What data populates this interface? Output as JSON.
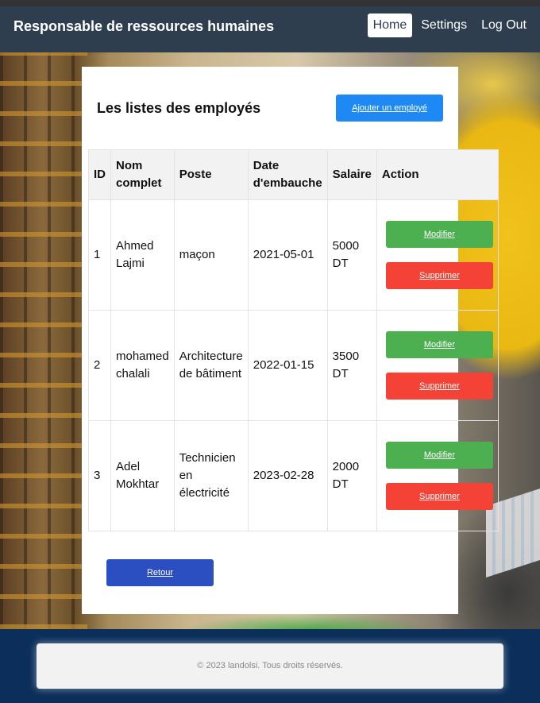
{
  "header": {
    "brand": "Responsable de ressources humaines",
    "nav": [
      {
        "label": "Home",
        "active": true
      },
      {
        "label": "Settings",
        "active": false
      },
      {
        "label": "Log Out",
        "active": false
      }
    ]
  },
  "main": {
    "title": "Les listes des employés",
    "add_button": "Ajouter un employé",
    "table": {
      "headers": [
        "ID",
        "Nom complet",
        "Poste",
        "Date d'embauche",
        "Salaire",
        "Action"
      ],
      "rows": [
        {
          "id": "1",
          "name": "Ahmed Lajmi",
          "poste": "maçon",
          "date": "2021-05-01",
          "salaire": "5000 DT"
        },
        {
          "id": "2",
          "name": "mohamed chalali",
          "poste": "Architecture de bâtiment",
          "date": "2022-01-15",
          "salaire": "3500 DT"
        },
        {
          "id": "3",
          "name": "Adel Mokhtar",
          "poste": "Technicien en électricité",
          "date": "2023-02-28",
          "salaire": "2000 DT"
        }
      ],
      "edit_label": "Modifier",
      "delete_label": "Supprimer"
    },
    "back_button": "Retour"
  },
  "footer": {
    "text": "© 2023 landolsi. Tous droits réservés."
  },
  "colors": {
    "header_bg": "#2f3e4f",
    "add_button": "#1e88f5",
    "edit_button": "#4caf50",
    "delete_button": "#f44336",
    "back_button": "#2b4fc0",
    "footer_bg": "#0b2f5a"
  }
}
